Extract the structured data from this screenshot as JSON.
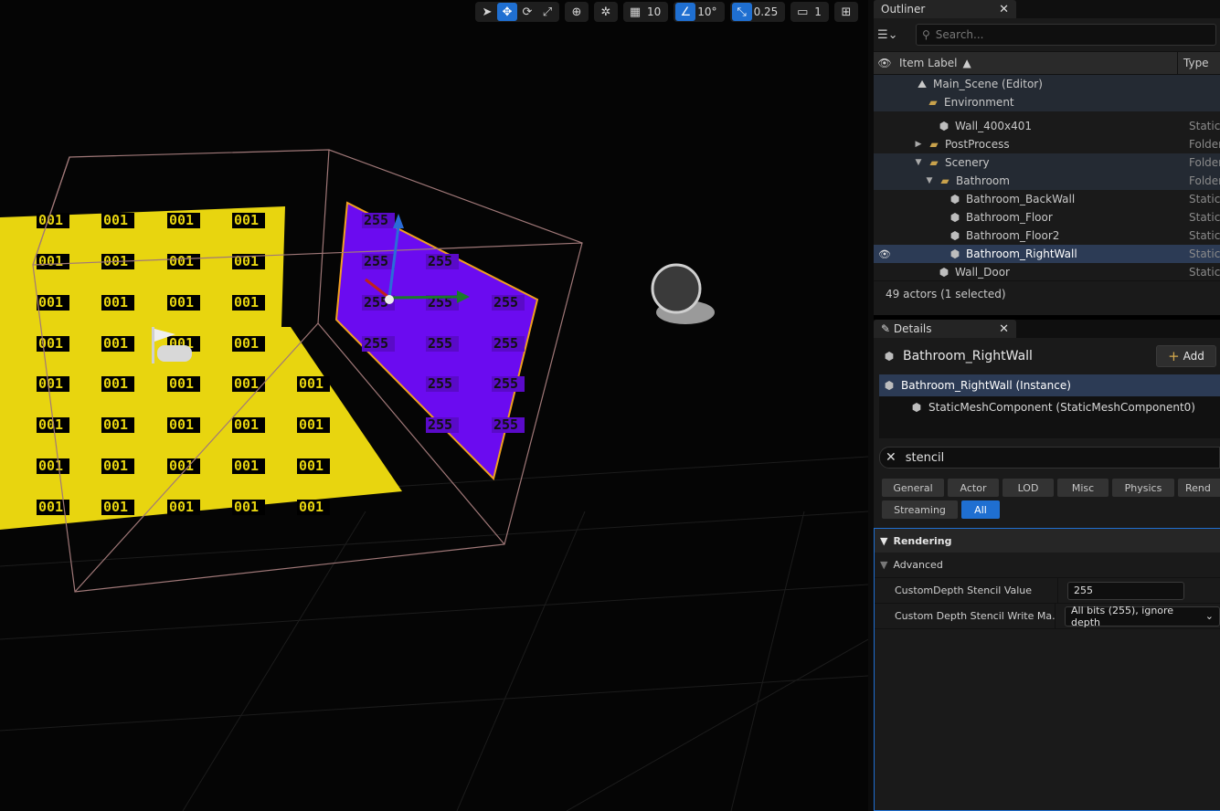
{
  "toolbar": {
    "grid_value": "10",
    "angle_value": "10°",
    "scale_value": "0.25",
    "camera_speed": "1"
  },
  "scene": {
    "yellow_labels": [
      "001"
    ],
    "purple_labels": [
      "255"
    ]
  },
  "outliner": {
    "tab_title": "Outliner",
    "search_placeholder": "Search...",
    "col_label": "Item Label",
    "col_type": "Type",
    "rows": [
      {
        "name": "Main_Scene (Editor)",
        "type": ""
      },
      {
        "name": "Environment",
        "type": ""
      },
      {
        "name": "Wall_400x401",
        "type": "Static"
      },
      {
        "name": "PostProcess",
        "type": "Folder"
      },
      {
        "name": "Scenery",
        "type": "Folder"
      },
      {
        "name": "Bathroom",
        "type": "Folder"
      },
      {
        "name": "Bathroom_BackWall",
        "type": "Static"
      },
      {
        "name": "Bathroom_Floor",
        "type": "Static"
      },
      {
        "name": "Bathroom_Floor2",
        "type": "Static"
      },
      {
        "name": "Bathroom_RightWall",
        "type": "Static"
      },
      {
        "name": "Wall_Door",
        "type": "Static"
      }
    ],
    "footer": "49 actors (1 selected)"
  },
  "details": {
    "tab_title": "Details",
    "object_name": "Bathroom_RightWall",
    "add_label": "Add",
    "components": [
      {
        "name": "Bathroom_RightWall (Instance)"
      },
      {
        "name": "StaticMeshComponent (StaticMeshComponent0)"
      }
    ],
    "filter_value": "stencil",
    "categories": [
      "General",
      "Actor",
      "LOD",
      "Misc",
      "Physics",
      "Rend",
      "Streaming",
      "All"
    ],
    "section": "Rendering",
    "subsection": "Advanced",
    "props": [
      {
        "name": "CustomDepth Stencil Value",
        "value": "255"
      },
      {
        "name": "Custom Depth Stencil Write Ma...",
        "value": "All bits (255), ignore depth"
      }
    ]
  }
}
